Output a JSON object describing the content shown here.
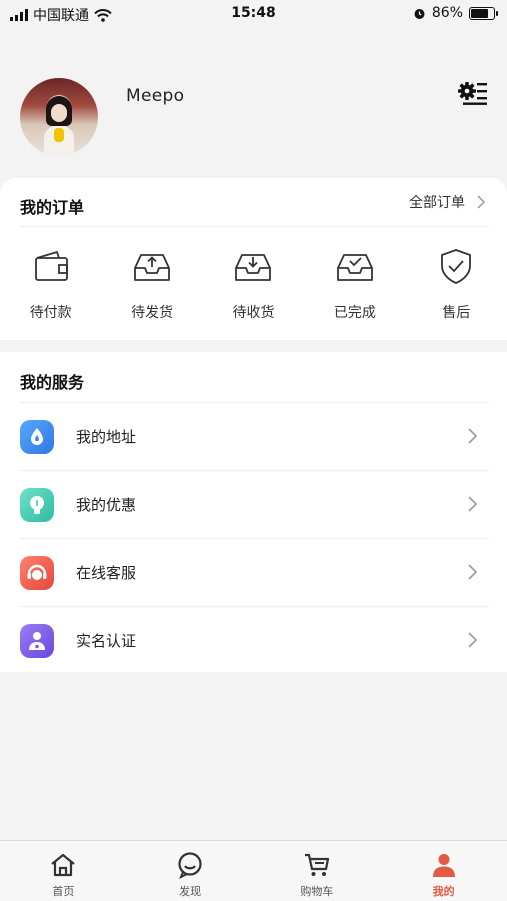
{
  "status_bar": {
    "carrier": "中国联通",
    "time": "15:48",
    "battery_percent": "86%",
    "battery_level": 0.86
  },
  "profile": {
    "username": "Meepo",
    "avatar_icon": "user-avatar-photo",
    "settings_icon": "gear-list-icon"
  },
  "orders": {
    "title": "我的订单",
    "all_orders_label": "全部订单",
    "items": [
      {
        "label": "待付款",
        "icon": "wallet-icon"
      },
      {
        "label": "待发货",
        "icon": "box-upload-icon"
      },
      {
        "label": "待收货",
        "icon": "box-download-icon"
      },
      {
        "label": "已完成",
        "icon": "box-check-icon"
      },
      {
        "label": "售后",
        "icon": "shield-check-icon"
      }
    ]
  },
  "services": {
    "title": "我的服务",
    "items": [
      {
        "label": "我的地址",
        "icon": "location-drop-icon",
        "color": "#3f8ef0"
      },
      {
        "label": "我的优惠",
        "icon": "lightbulb-icon",
        "color": "#3ec9b0"
      },
      {
        "label": "在线客服",
        "icon": "customer-service-icon",
        "color": "#ee6152"
      },
      {
        "label": "实名认证",
        "icon": "user-verify-icon",
        "color": "#7b5be6"
      }
    ]
  },
  "tabbar": {
    "tabs": [
      {
        "label": "首页",
        "icon": "home-icon",
        "active": false
      },
      {
        "label": "发现",
        "icon": "chat-bubble-icon",
        "active": false
      },
      {
        "label": "购物车",
        "icon": "cart-icon",
        "active": false
      },
      {
        "label": "我的",
        "icon": "user-icon",
        "active": true
      }
    ],
    "active_color": "#e35a45"
  }
}
